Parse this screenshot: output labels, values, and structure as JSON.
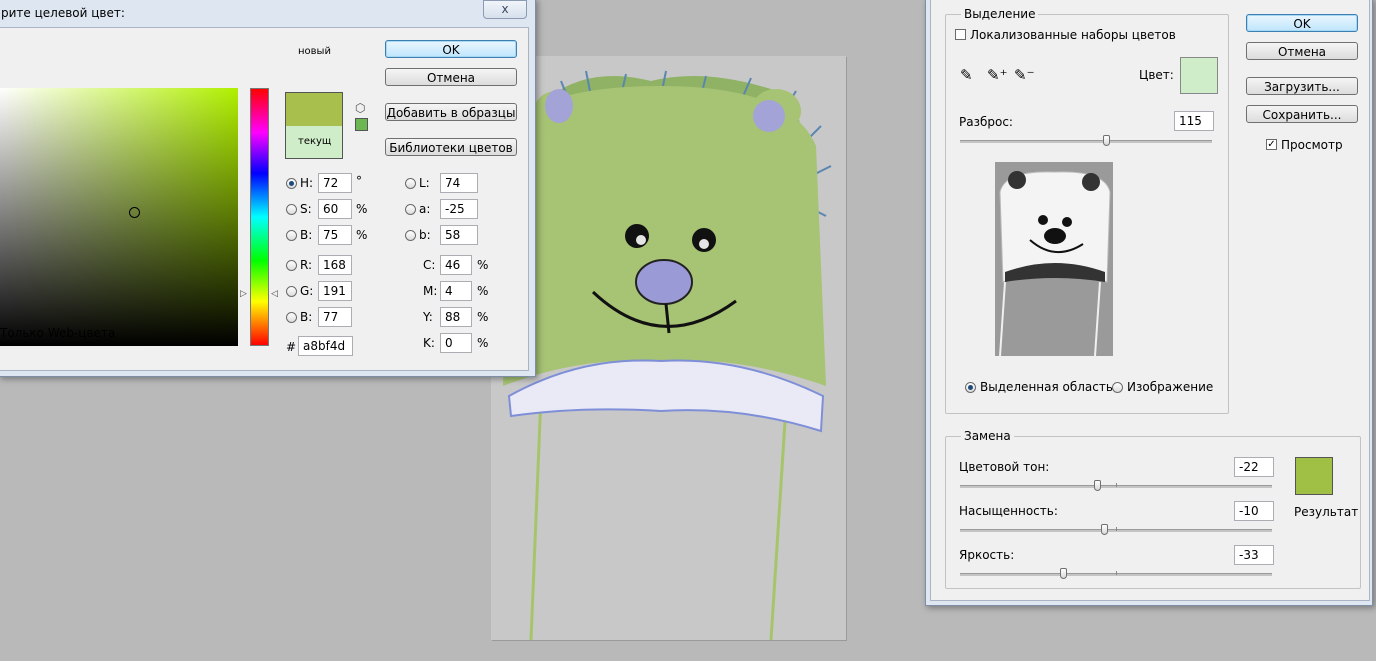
{
  "canvas": {},
  "picker": {
    "title": "рите целевой цвет:",
    "close": "x",
    "new_label": "новый",
    "current_label": "текущ",
    "new_color": "#a8bf4d",
    "current_color": "#d0edc9",
    "web_only_label": "Только Web-цвета",
    "buttons": {
      "ok": "OK",
      "cancel": "Отмена",
      "add_swatches": "Добавить в образцы",
      "libraries": "Библиотеки цветов"
    },
    "hsb": [
      {
        "label": "H:",
        "value": "72",
        "unit": "°",
        "selected": true
      },
      {
        "label": "S:",
        "value": "60",
        "unit": "%",
        "selected": false
      },
      {
        "label": "B:",
        "value": "75",
        "unit": "%",
        "selected": false
      }
    ],
    "rgb": [
      {
        "label": "R:",
        "value": "168"
      },
      {
        "label": "G:",
        "value": "191"
      },
      {
        "label": "B:",
        "value": "77"
      }
    ],
    "lab": [
      {
        "label": "L:",
        "value": "74"
      },
      {
        "label": "a:",
        "value": "-25"
      },
      {
        "label": "b:",
        "value": "58"
      }
    ],
    "cmyk": [
      {
        "label": "C:",
        "value": "46",
        "unit": "%"
      },
      {
        "label": "M:",
        "value": "4",
        "unit": "%"
      },
      {
        "label": "Y:",
        "value": "88",
        "unit": "%"
      },
      {
        "label": "K:",
        "value": "0",
        "unit": "%"
      }
    ],
    "hex_label": "#",
    "hex_value": "a8bf4d"
  },
  "replace": {
    "selection_group": "Выделение",
    "localized_label": "Локализованные наборы цветов",
    "localized_checked": false,
    "color_label": "Цвет:",
    "selection_color": "#d0edc9",
    "fuzziness_label": "Разброс:",
    "fuzziness_value": "115",
    "fuzziness_fraction": 0.58,
    "radio_selection": "Выделенная область",
    "radio_image": "Изображение",
    "buttons": {
      "ok": "OK",
      "cancel": "Отмена",
      "load": "Загрузить...",
      "save": "Сохранить..."
    },
    "preview_label": "Просмотр",
    "preview_checked": true,
    "replace_group": "Замена",
    "hue_label": "Цветовой тон:",
    "hue_value": "-22",
    "hue_fraction": 0.44,
    "saturation_label": "Насыщенность:",
    "saturation_value": "-10",
    "saturation_fraction": 0.46,
    "lightness_label": "Яркость:",
    "lightness_value": "-33",
    "lightness_fraction": 0.33,
    "result_label": "Результат",
    "result_color": "#a0bf45"
  }
}
